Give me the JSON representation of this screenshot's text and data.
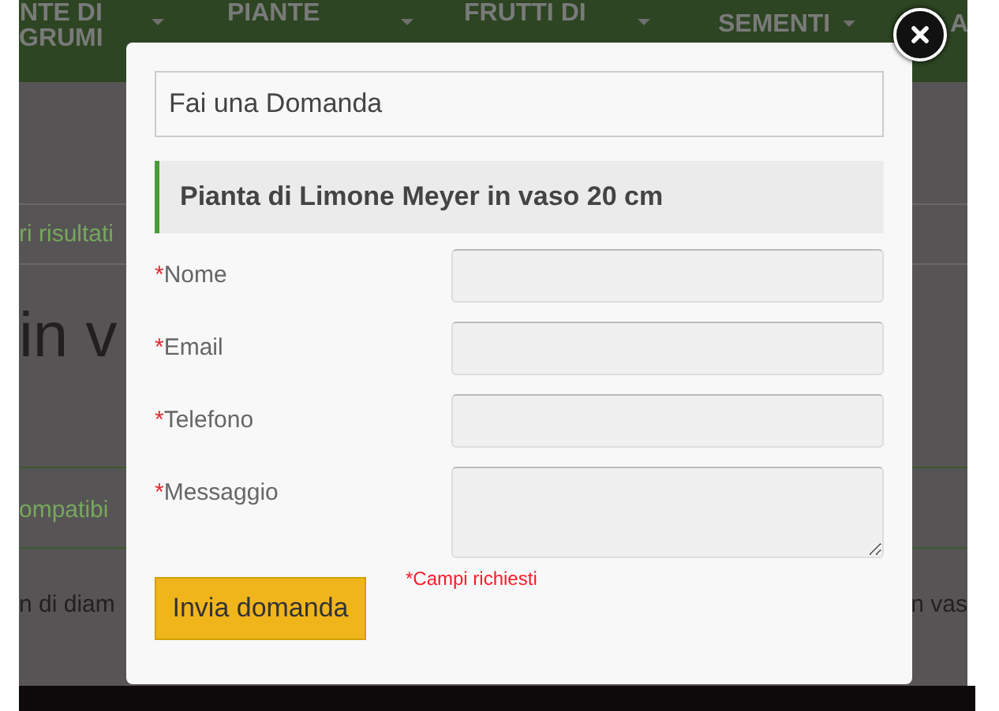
{
  "nav": {
    "items": [
      {
        "lines": [
          "NTE DI",
          "GRUMI"
        ],
        "caret": true
      },
      {
        "lines": [
          "PIANTE"
        ],
        "caret": true
      },
      {
        "lines": [
          "FRUTTI DI"
        ],
        "caret": true
      },
      {
        "lines": [
          "SEMENTI"
        ],
        "caret": true
      },
      {
        "lines": [
          "A"
        ],
        "caret": false
      }
    ]
  },
  "background_page": {
    "breadcrumb": "ri risultati",
    "heading": "in v",
    "tab": "ompatibi",
    "text_left": "n di diam",
    "text_right": "n vas"
  },
  "dialog": {
    "title": "Fai una Domanda",
    "product": "Pianta di Limone Meyer in vaso 20 cm",
    "fields": [
      {
        "mark": "*",
        "label": "Nome",
        "kind": "input"
      },
      {
        "mark": "*",
        "label": "Email",
        "kind": "input"
      },
      {
        "mark": "*",
        "label": "Telefono",
        "kind": "input"
      },
      {
        "mark": "*",
        "label": "Messaggio",
        "kind": "textarea"
      }
    ],
    "required_note": "*Campi richiesti",
    "submit": "Invia domanda"
  }
}
